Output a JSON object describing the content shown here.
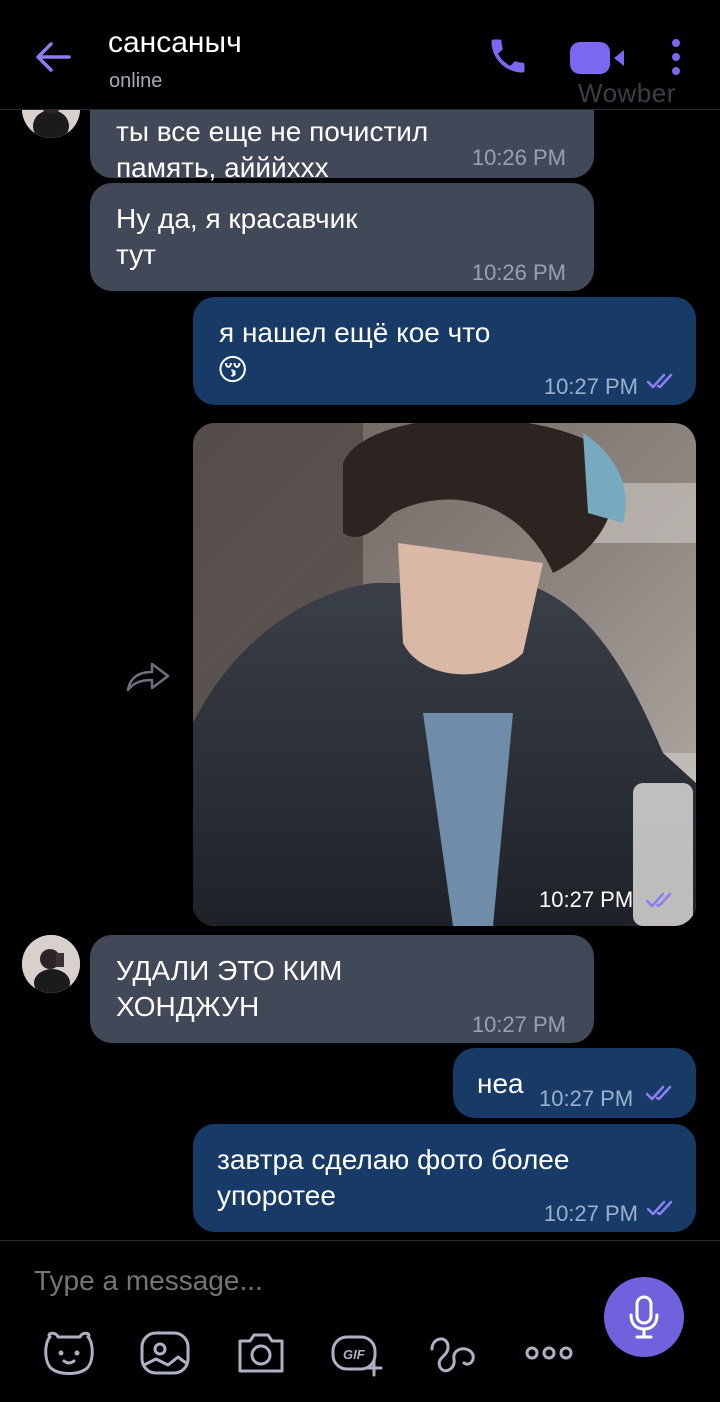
{
  "header": {
    "contact_name": "сансаныч",
    "status": "online",
    "watermark": "Wowber"
  },
  "messages": [
    {
      "direction": "in",
      "text": "ты все еще не почистил\nпамять, айййххх",
      "time": "10:26 PM"
    },
    {
      "direction": "in",
      "text": "Ну да, я красавчик\nтут",
      "time": "10:26 PM"
    },
    {
      "direction": "out",
      "text": "я нашел ещё кое что",
      "emoji": "😚",
      "time": "10:27 PM",
      "read": true
    },
    {
      "direction": "out",
      "type": "photo",
      "time": "10:27 PM",
      "read": true
    },
    {
      "direction": "in",
      "text": "УДАЛИ ЭТО КИМ\nХОНДЖУН",
      "time": "10:27 PM"
    },
    {
      "direction": "out",
      "text": "неа",
      "time": "10:27 PM",
      "read": true
    },
    {
      "direction": "out",
      "text": "завтра сделаю фото более\nупоротее",
      "time": "10:27 PM",
      "read": true
    }
  ],
  "composer": {
    "placeholder": "Type a message...",
    "tools": [
      "sticker-icon",
      "image-icon",
      "camera-icon",
      "gif-icon",
      "doodle-icon",
      "more-options-icon"
    ],
    "gif_label": "GIF"
  },
  "colors": {
    "accent": "#7062dd",
    "incoming_bubble": "#414858",
    "outgoing_bubble": "#173a66",
    "background": "#000000"
  }
}
